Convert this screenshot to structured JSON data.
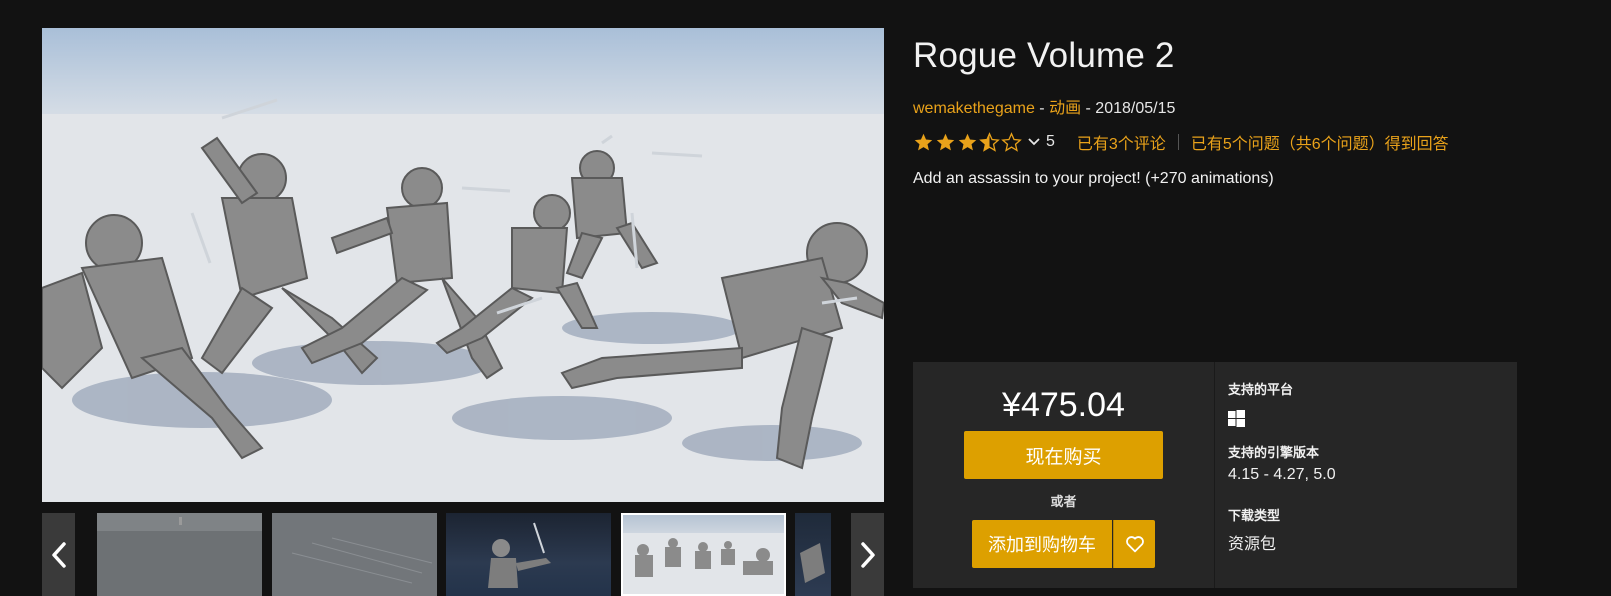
{
  "product": {
    "title": "Rogue Volume 2",
    "author": "wemakethegame",
    "meta_sep1": " - ",
    "category": "动画",
    "meta_sep2": " - ",
    "date": "2018/05/15",
    "rating_value": 3.5,
    "rating_count": "5",
    "reviews_link": "已有3个评论",
    "questions_link": "已有5个问题（共6个问题）得到回答",
    "description": "Add an assassin to your project! (+270 animations)"
  },
  "purchase": {
    "price": "¥475.04",
    "buy_now_label": "现在购买",
    "or_label": "或者",
    "add_to_cart_label": "添加到购物车"
  },
  "specs": {
    "platform_label": "支持的平台",
    "platform_icon": "windows-icon",
    "engine_label": "支持的引擎版本",
    "engine_value": "4.15 - 4.27, 5.0",
    "download_label": "下载类型",
    "download_value": "资源包"
  },
  "colors": {
    "accent": "#e9a21a",
    "button": "#dda000",
    "background": "#121212",
    "panel": "#262626"
  }
}
